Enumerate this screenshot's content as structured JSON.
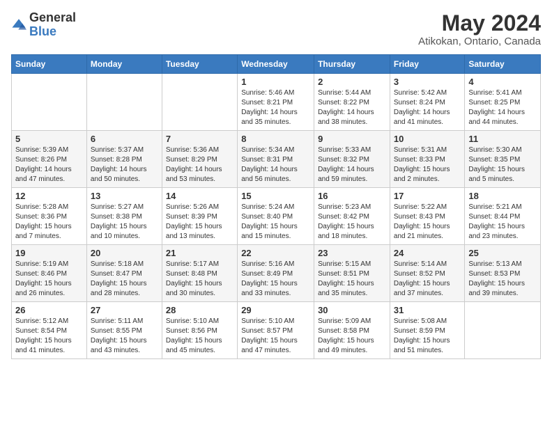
{
  "logo": {
    "text_general": "General",
    "text_blue": "Blue"
  },
  "title": "May 2024",
  "subtitle": "Atikokan, Ontario, Canada",
  "weekdays": [
    "Sunday",
    "Monday",
    "Tuesday",
    "Wednesday",
    "Thursday",
    "Friday",
    "Saturday"
  ],
  "weeks": [
    [
      {
        "day": "",
        "sunrise": "",
        "sunset": "",
        "daylight": ""
      },
      {
        "day": "",
        "sunrise": "",
        "sunset": "",
        "daylight": ""
      },
      {
        "day": "",
        "sunrise": "",
        "sunset": "",
        "daylight": ""
      },
      {
        "day": "1",
        "sunrise": "Sunrise: 5:46 AM",
        "sunset": "Sunset: 8:21 PM",
        "daylight": "Daylight: 14 hours and 35 minutes."
      },
      {
        "day": "2",
        "sunrise": "Sunrise: 5:44 AM",
        "sunset": "Sunset: 8:22 PM",
        "daylight": "Daylight: 14 hours and 38 minutes."
      },
      {
        "day": "3",
        "sunrise": "Sunrise: 5:42 AM",
        "sunset": "Sunset: 8:24 PM",
        "daylight": "Daylight: 14 hours and 41 minutes."
      },
      {
        "day": "4",
        "sunrise": "Sunrise: 5:41 AM",
        "sunset": "Sunset: 8:25 PM",
        "daylight": "Daylight: 14 hours and 44 minutes."
      }
    ],
    [
      {
        "day": "5",
        "sunrise": "Sunrise: 5:39 AM",
        "sunset": "Sunset: 8:26 PM",
        "daylight": "Daylight: 14 hours and 47 minutes."
      },
      {
        "day": "6",
        "sunrise": "Sunrise: 5:37 AM",
        "sunset": "Sunset: 8:28 PM",
        "daylight": "Daylight: 14 hours and 50 minutes."
      },
      {
        "day": "7",
        "sunrise": "Sunrise: 5:36 AM",
        "sunset": "Sunset: 8:29 PM",
        "daylight": "Daylight: 14 hours and 53 minutes."
      },
      {
        "day": "8",
        "sunrise": "Sunrise: 5:34 AM",
        "sunset": "Sunset: 8:31 PM",
        "daylight": "Daylight: 14 hours and 56 minutes."
      },
      {
        "day": "9",
        "sunrise": "Sunrise: 5:33 AM",
        "sunset": "Sunset: 8:32 PM",
        "daylight": "Daylight: 14 hours and 59 minutes."
      },
      {
        "day": "10",
        "sunrise": "Sunrise: 5:31 AM",
        "sunset": "Sunset: 8:33 PM",
        "daylight": "Daylight: 15 hours and 2 minutes."
      },
      {
        "day": "11",
        "sunrise": "Sunrise: 5:30 AM",
        "sunset": "Sunset: 8:35 PM",
        "daylight": "Daylight: 15 hours and 5 minutes."
      }
    ],
    [
      {
        "day": "12",
        "sunrise": "Sunrise: 5:28 AM",
        "sunset": "Sunset: 8:36 PM",
        "daylight": "Daylight: 15 hours and 7 minutes."
      },
      {
        "day": "13",
        "sunrise": "Sunrise: 5:27 AM",
        "sunset": "Sunset: 8:38 PM",
        "daylight": "Daylight: 15 hours and 10 minutes."
      },
      {
        "day": "14",
        "sunrise": "Sunrise: 5:26 AM",
        "sunset": "Sunset: 8:39 PM",
        "daylight": "Daylight: 15 hours and 13 minutes."
      },
      {
        "day": "15",
        "sunrise": "Sunrise: 5:24 AM",
        "sunset": "Sunset: 8:40 PM",
        "daylight": "Daylight: 15 hours and 15 minutes."
      },
      {
        "day": "16",
        "sunrise": "Sunrise: 5:23 AM",
        "sunset": "Sunset: 8:42 PM",
        "daylight": "Daylight: 15 hours and 18 minutes."
      },
      {
        "day": "17",
        "sunrise": "Sunrise: 5:22 AM",
        "sunset": "Sunset: 8:43 PM",
        "daylight": "Daylight: 15 hours and 21 minutes."
      },
      {
        "day": "18",
        "sunrise": "Sunrise: 5:21 AM",
        "sunset": "Sunset: 8:44 PM",
        "daylight": "Daylight: 15 hours and 23 minutes."
      }
    ],
    [
      {
        "day": "19",
        "sunrise": "Sunrise: 5:19 AM",
        "sunset": "Sunset: 8:46 PM",
        "daylight": "Daylight: 15 hours and 26 minutes."
      },
      {
        "day": "20",
        "sunrise": "Sunrise: 5:18 AM",
        "sunset": "Sunset: 8:47 PM",
        "daylight": "Daylight: 15 hours and 28 minutes."
      },
      {
        "day": "21",
        "sunrise": "Sunrise: 5:17 AM",
        "sunset": "Sunset: 8:48 PM",
        "daylight": "Daylight: 15 hours and 30 minutes."
      },
      {
        "day": "22",
        "sunrise": "Sunrise: 5:16 AM",
        "sunset": "Sunset: 8:49 PM",
        "daylight": "Daylight: 15 hours and 33 minutes."
      },
      {
        "day": "23",
        "sunrise": "Sunrise: 5:15 AM",
        "sunset": "Sunset: 8:51 PM",
        "daylight": "Daylight: 15 hours and 35 minutes."
      },
      {
        "day": "24",
        "sunrise": "Sunrise: 5:14 AM",
        "sunset": "Sunset: 8:52 PM",
        "daylight": "Daylight: 15 hours and 37 minutes."
      },
      {
        "day": "25",
        "sunrise": "Sunrise: 5:13 AM",
        "sunset": "Sunset: 8:53 PM",
        "daylight": "Daylight: 15 hours and 39 minutes."
      }
    ],
    [
      {
        "day": "26",
        "sunrise": "Sunrise: 5:12 AM",
        "sunset": "Sunset: 8:54 PM",
        "daylight": "Daylight: 15 hours and 41 minutes."
      },
      {
        "day": "27",
        "sunrise": "Sunrise: 5:11 AM",
        "sunset": "Sunset: 8:55 PM",
        "daylight": "Daylight: 15 hours and 43 minutes."
      },
      {
        "day": "28",
        "sunrise": "Sunrise: 5:10 AM",
        "sunset": "Sunset: 8:56 PM",
        "daylight": "Daylight: 15 hours and 45 minutes."
      },
      {
        "day": "29",
        "sunrise": "Sunrise: 5:10 AM",
        "sunset": "Sunset: 8:57 PM",
        "daylight": "Daylight: 15 hours and 47 minutes."
      },
      {
        "day": "30",
        "sunrise": "Sunrise: 5:09 AM",
        "sunset": "Sunset: 8:58 PM",
        "daylight": "Daylight: 15 hours and 49 minutes."
      },
      {
        "day": "31",
        "sunrise": "Sunrise: 5:08 AM",
        "sunset": "Sunset: 8:59 PM",
        "daylight": "Daylight: 15 hours and 51 minutes."
      },
      {
        "day": "",
        "sunrise": "",
        "sunset": "",
        "daylight": ""
      }
    ]
  ]
}
